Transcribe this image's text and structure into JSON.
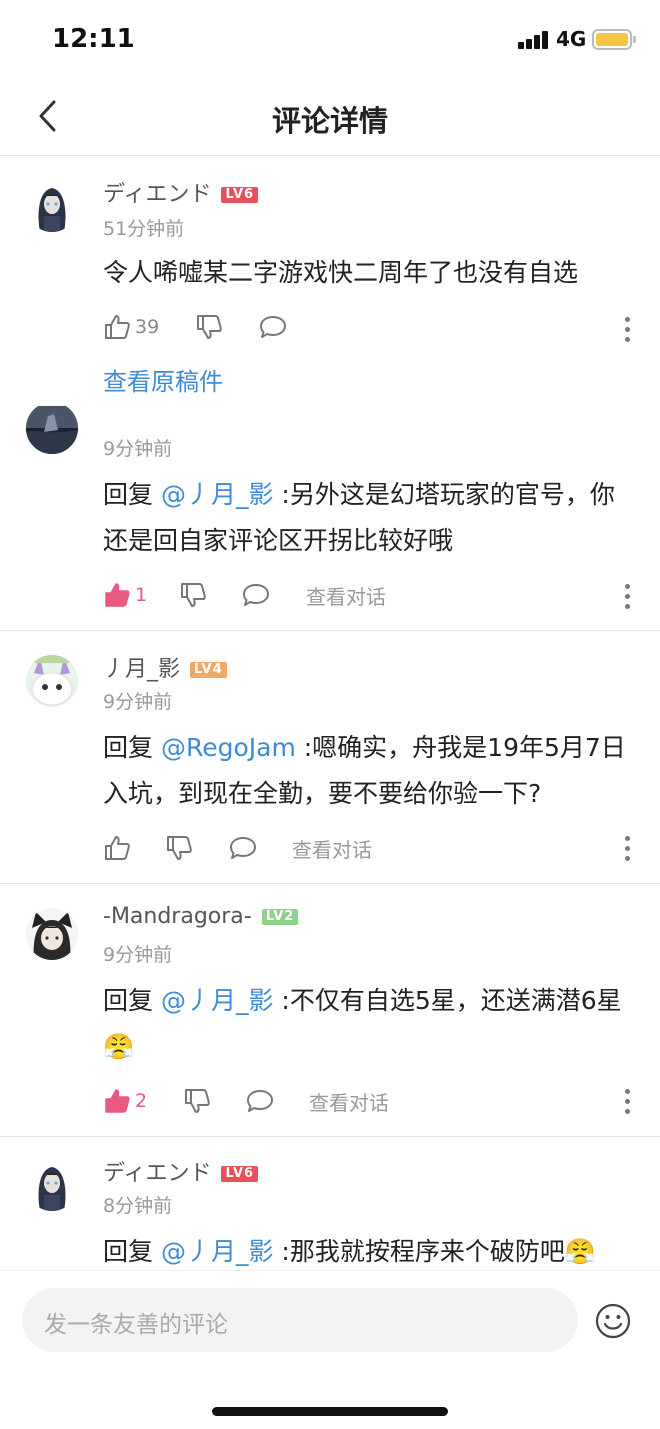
{
  "status": {
    "time": "12:11",
    "network": "4G"
  },
  "nav": {
    "title": "评论详情"
  },
  "main_comment": {
    "user": "ディエンド",
    "level": "LV6",
    "level_color": "#e8505b",
    "time": "51分钟前",
    "text": "令人唏嘘某二字游戏快二周年了也没有自选",
    "likes": "39",
    "view_original": "查看原稿件"
  },
  "replies": [
    {
      "user": "",
      "time": "9分钟前",
      "prefix": "回复 ",
      "mention": "@丿月_影",
      "text": " :另外这是幻塔玩家的官号，你还是回自家评论区开拐比较好哦",
      "likes": "1",
      "liked": true,
      "view_conversation": "查看对话"
    },
    {
      "user": "丿月_影",
      "level": "LV4",
      "level_color": "#f2a869",
      "time": "9分钟前",
      "prefix": "回复 ",
      "mention": "@RegoJam",
      "text": " :嗯确实，舟我是19年5月7日入坑，到现在全勤，要不要给你验一下?",
      "likes": "",
      "liked": false,
      "view_conversation": "查看对话"
    },
    {
      "user": "-Mandragora-",
      "level": "LV2",
      "level_color": "#8fd08a",
      "time": "9分钟前",
      "prefix": "回复 ",
      "mention": "@丿月_影",
      "text": " :不仅有自选5星，还送满潜6星😤",
      "likes": "2",
      "liked": true,
      "view_conversation": "查看对话"
    },
    {
      "user": "ディエンド",
      "level": "LV6",
      "level_color": "#e8505b",
      "time": "8分钟前",
      "prefix": "回复 ",
      "mention": "@丿月_影",
      "text": " :那我就按程序来个破防吧😤"
    }
  ],
  "input": {
    "placeholder": "发一条友善的评论"
  },
  "icons": [
    "back-icon",
    "like-icon",
    "dislike-icon",
    "comment-icon",
    "more-icon",
    "emoji-icon",
    "signal-icon",
    "battery-icon"
  ]
}
